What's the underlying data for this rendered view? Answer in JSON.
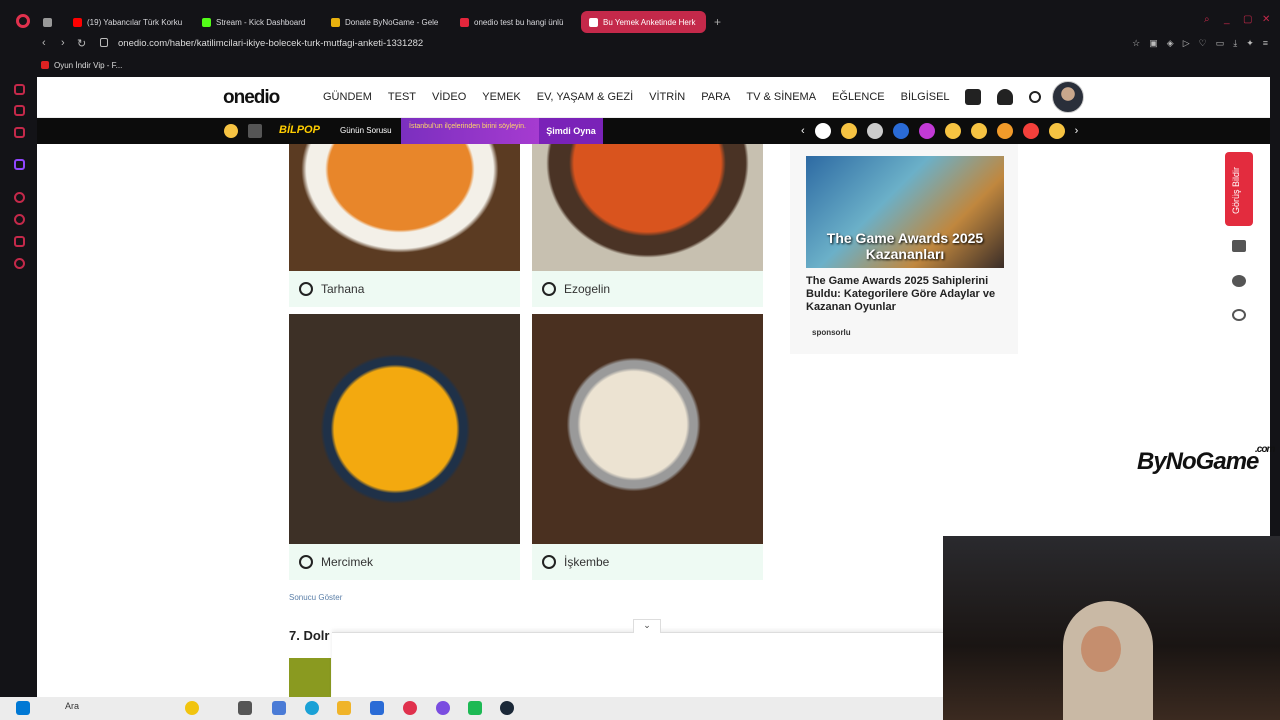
{
  "browser": {
    "tabs": [
      {
        "label": "",
        "color": "#999"
      },
      {
        "label": "(19) Yabancılar Türk Korku",
        "color": "#ff0000"
      },
      {
        "label": "Stream - Kick Dashboard",
        "color": "#53fc18"
      },
      {
        "label": "Donate ByNoGame - Gele",
        "color": "#e8b10e"
      },
      {
        "label": "onedio test bu hangi ünlü",
        "color": "#e4263c"
      },
      {
        "label": "Bu Yemek Anketinde Herk",
        "color": "#ffffff",
        "active": true
      }
    ],
    "url": "onedio.com/haber/katilimcilari-ikiye-bolecek-turk-mutfagi-anketi-1331282",
    "bookmark": "Oyun İndir Vip - F..."
  },
  "site": {
    "brand": "onedio",
    "nav": [
      "GÜNDEM",
      "TEST",
      "VİDEO",
      "YEMEK",
      "EV, YAŞAM & GEZİ",
      "VİTRİN",
      "PARA",
      "TV & SİNEMA",
      "EĞLENCE",
      "BİLGİSEL"
    ],
    "strip": {
      "bilpop": "BİLPOP",
      "gunun": "Günün Sorusu",
      "promo": "İstanbul'un ilçelerinden birini söyleyin.",
      "play": "Şimdi Oyna"
    }
  },
  "poll": {
    "options": [
      {
        "label": "Tarhana"
      },
      {
        "label": "Ezogelin"
      },
      {
        "label": "Mercimek"
      },
      {
        "label": "İşkembe"
      }
    ],
    "show_results": "Sonucu Göster",
    "next_question": "7. Dolr"
  },
  "sidebar_card": {
    "image_text": "The Game Awards 2025 Kazananları",
    "title": "The Game Awards 2025 Sahiplerini Buldu: Kategorilere Göre Adaylar ve Kazanan Oyunlar",
    "sponsored": "sponsorlu"
  },
  "feedback": "Görüş Bildir",
  "watermark": {
    "name": "ByNoGame",
    "suffix": ".com"
  },
  "taskbar": {
    "search": "Ara"
  }
}
